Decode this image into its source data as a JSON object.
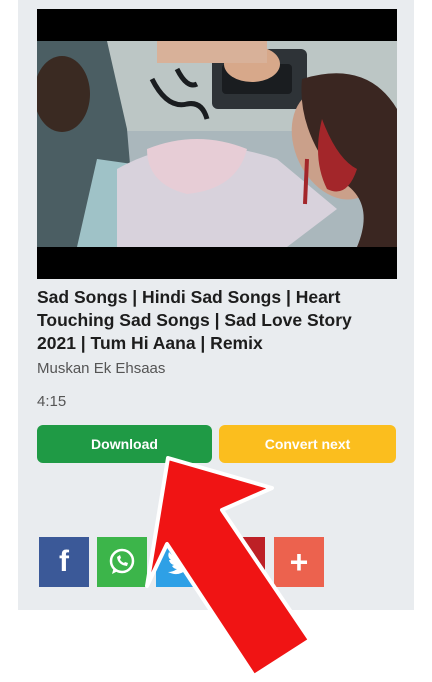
{
  "video": {
    "title": "Sad Songs | Hindi Sad Songs | Heart Touching Sad Songs | Sad Love Story 2021 | Tum Hi Aana | Remix",
    "channel": "Muskan Ek Ehsaas",
    "duration": "4:15"
  },
  "actions": {
    "download_label": "Download",
    "convert_label": "Convert next"
  },
  "share": {
    "facebook_glyph": "f",
    "whatsapp_icon": "whatsapp-icon",
    "twitter_icon": "twitter-icon",
    "pinterest_icon": "pinterest-icon",
    "more_glyph": "+"
  },
  "colors": {
    "download": "#1f9a45",
    "convert": "#fbbe1e",
    "facebook": "#3b5998",
    "whatsapp": "#3cb54a",
    "twitter": "#2ea0e6",
    "pinterest": "#bd2026",
    "more": "#ec624e",
    "annotation_arrow": "#f01414"
  }
}
